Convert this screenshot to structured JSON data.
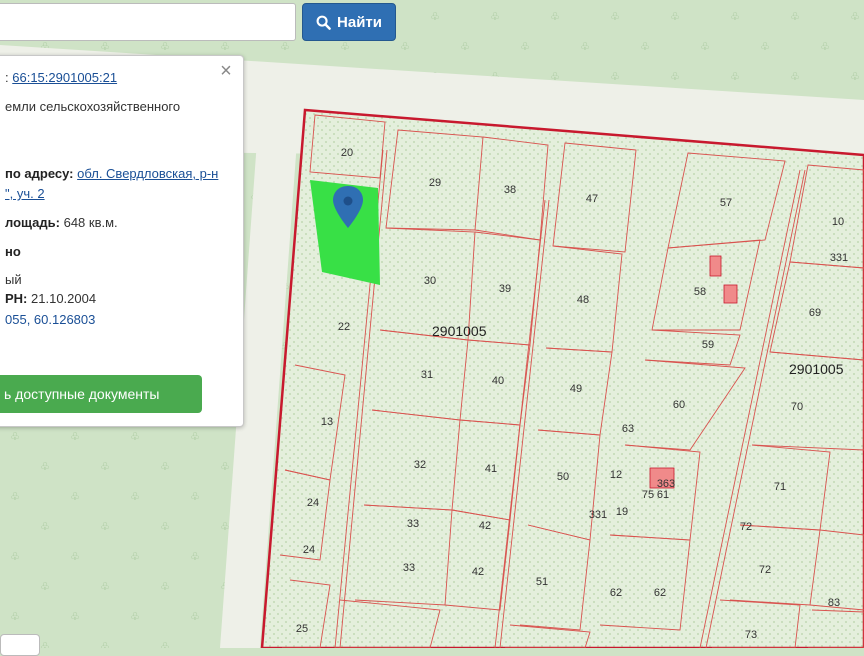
{
  "search": {
    "value": "",
    "placeholder": "",
    "button_label": "Найти"
  },
  "popup": {
    "line1_prefix": ":",
    "cadastral_number": "66:15:2901005:21",
    "category": "емли сельскохозяйственного",
    "address_label": "по адресу:",
    "address_link1": "обл. Свердловская, р-н",
    "address_link2": "\", уч. 2",
    "area_label": "лощадь:",
    "area_value": "648 кв.м.",
    "status_fragment": "но",
    "type_fragment": "ый",
    "date_label": "РН:",
    "date_value": "21.10.2004",
    "coords": "055, 60.126803",
    "docs_button": "ь доступные документы"
  },
  "quarters": {
    "left": "2901005",
    "right": "2901005"
  },
  "parcels": [
    "20",
    "29",
    "38",
    "47",
    "57",
    "10",
    "331",
    "30",
    "39",
    "48",
    "58",
    "69",
    "22",
    "59",
    "31",
    "40",
    "49",
    "60",
    "70",
    "13",
    "63",
    "32",
    "41",
    "50",
    "75",
    "61",
    "71",
    "24",
    "331",
    "72",
    "33",
    "42",
    "24",
    "33",
    "42",
    "51",
    "62",
    "62",
    "72",
    "25",
    "73",
    "83",
    "19",
    "12",
    "363"
  ],
  "colors": {
    "map_bg": "#cfe3c6",
    "parcel_fill": "#e8f1e1",
    "boundary": "#c8192e",
    "selected": "#38e046",
    "button": "#2f6fb3",
    "docs_button": "#4aaa4f"
  },
  "icons": {
    "search": "search-icon",
    "marker": "map-marker-icon",
    "close": "close-icon"
  }
}
